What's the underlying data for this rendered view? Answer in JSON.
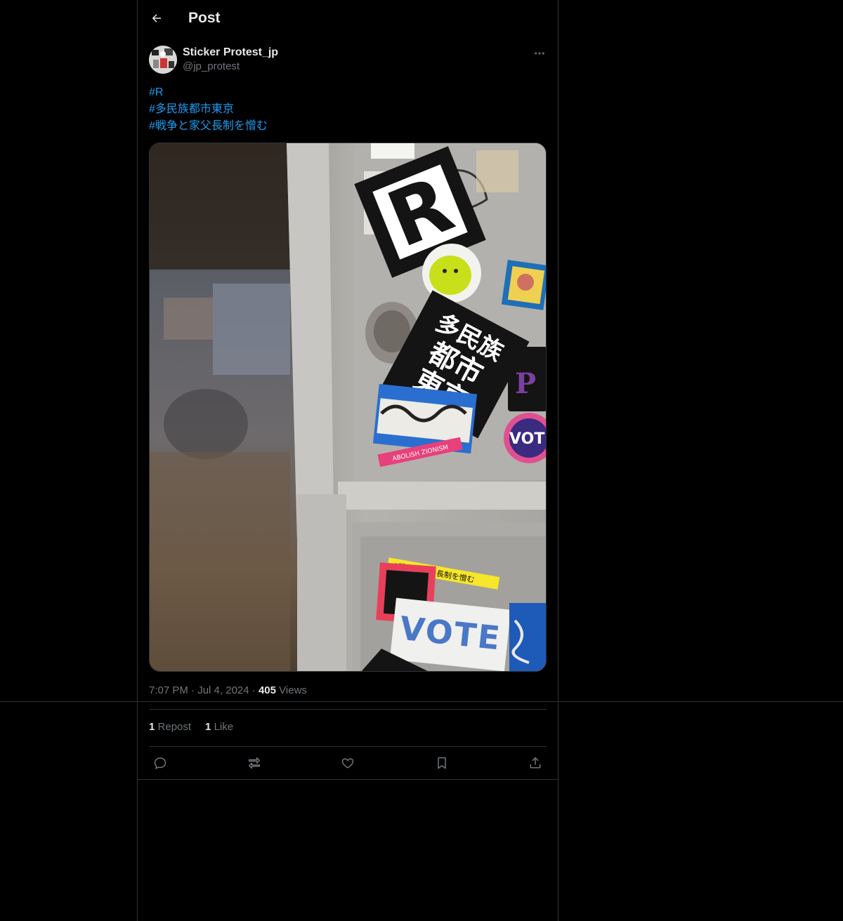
{
  "header": {
    "title": "Post"
  },
  "author": {
    "display_name": "Sticker Protest_jp",
    "handle": "@jp_protest"
  },
  "tweet": {
    "hashtags": [
      "#R",
      "#多民族都市東京",
      "#戦争と家父長制を憎む"
    ]
  },
  "media": {
    "sticker_r": "R",
    "sticker_city": [
      "多民族",
      "都市",
      "東京"
    ],
    "sticker_abolish": "ABOLISH ZIONISM",
    "sticker_vote_round": "VOT",
    "sticker_hate": "#戦争と家父長制を憎む",
    "sticker_vote_bead": "VOTE"
  },
  "meta": {
    "time": "7:07 PM",
    "date": "Jul 4, 2024",
    "views_count": "405",
    "views_label": "Views"
  },
  "stats": {
    "reposts_count": "1",
    "reposts_label": "Repost",
    "likes_count": "1",
    "likes_label": "Like"
  },
  "icons": [
    "back-arrow-icon",
    "more-icon",
    "reply-icon",
    "repost-icon",
    "like-icon",
    "bookmark-icon",
    "share-icon"
  ],
  "colors": {
    "accent": "#1d9bf0",
    "background": "#000000",
    "border": "#2f3336",
    "muted": "#71767b"
  }
}
